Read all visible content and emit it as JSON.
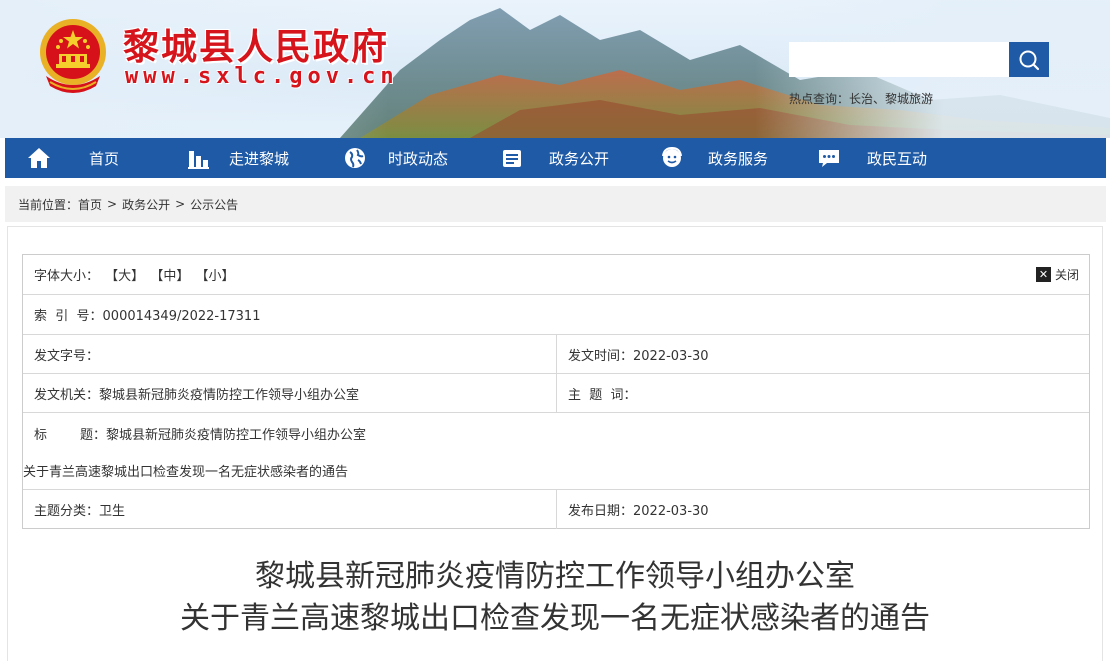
{
  "header": {
    "site_title": "黎城县人民政府",
    "site_url": "www.sxlc.gov.cn",
    "search_placeholder": "",
    "hot_search": "热点查询：长治、黎城旅游"
  },
  "nav": {
    "items": [
      {
        "label": "首页",
        "icon": "home-icon"
      },
      {
        "label": "走进黎城",
        "icon": "city-icon"
      },
      {
        "label": "时政动态",
        "icon": "globe-icon"
      },
      {
        "label": "政务公开",
        "icon": "document-icon"
      },
      {
        "label": "政务服务",
        "icon": "service-icon"
      },
      {
        "label": "政民互动",
        "icon": "chat-icon"
      }
    ]
  },
  "breadcrumb": {
    "prefix": "当前位置：",
    "items": [
      "首页",
      "政务公开",
      "公示公告"
    ],
    "separator": ">"
  },
  "info": {
    "font_size_label": "字体大小：",
    "font_sizes": [
      "【大】",
      "【中】",
      "【小】"
    ],
    "close_label": "关闭",
    "index_no": "索  引  号：000014349/2022-17311",
    "doc_no": "发文字号：",
    "doc_time": "发文时间：2022-03-30",
    "issuer": "发文机关：黎城县新冠肺炎疫情防控工作领导小组办公室",
    "keywords": "主  题  词：",
    "title_line1": "标        题：黎城县新冠肺炎疫情防控工作领导小组办公室",
    "title_line2": "关于青兰高速黎城出口检查发现一名无症状感染者的通告",
    "category": "主题分类：卫生",
    "publish_date": "发布日期：2022-03-30"
  },
  "document": {
    "title_line1": "黎城县新冠肺炎疫情防控工作领导小组办公室",
    "title_line2": "关于青兰高速黎城出口检查发现一名无症状感染者的通告"
  },
  "colors": {
    "primary": "#1f5aa6",
    "title_red": "#d5141b"
  }
}
